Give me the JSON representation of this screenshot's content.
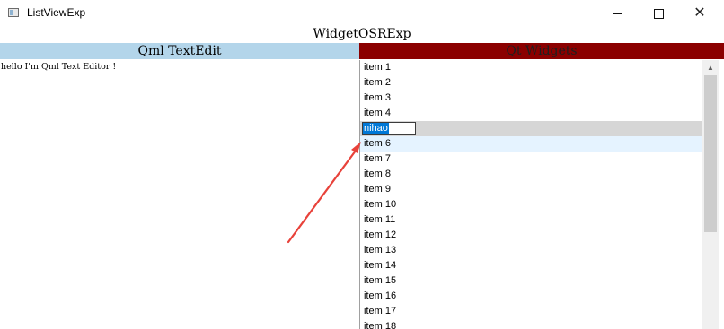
{
  "window": {
    "title": "ListViewExp",
    "minimize_icon": "minimize-icon",
    "maximize_icon": "maximize-icon",
    "close_icon": "close-icon",
    "close_glyph": "✕"
  },
  "main": {
    "title": "WidgetOSRExp"
  },
  "left_pane": {
    "header": "Qml TextEdit",
    "header_color": "#b3d5ea",
    "editor_text": "hello I'm Qml Text Editor !"
  },
  "right_pane": {
    "header": "Qt Widgets",
    "header_color": "#8b0000",
    "list": {
      "items": [
        "item 1",
        "item 2",
        "item 3",
        "item 4"
      ],
      "editing_value": "nihao",
      "after_items": [
        "item 6",
        "item 7",
        "item 8",
        "item 9",
        "item 10",
        "item 11",
        "item 12",
        "item 13",
        "item 14",
        "item 15",
        "item 16",
        "item 17",
        "item 18"
      ]
    },
    "scrollbar_up_glyph": "▲"
  },
  "colors": {
    "selection": "#0078d7",
    "hover_row": "#e5f3ff",
    "editing_row": "#d6d6d6",
    "annotation_arrow": "#e8423a"
  }
}
